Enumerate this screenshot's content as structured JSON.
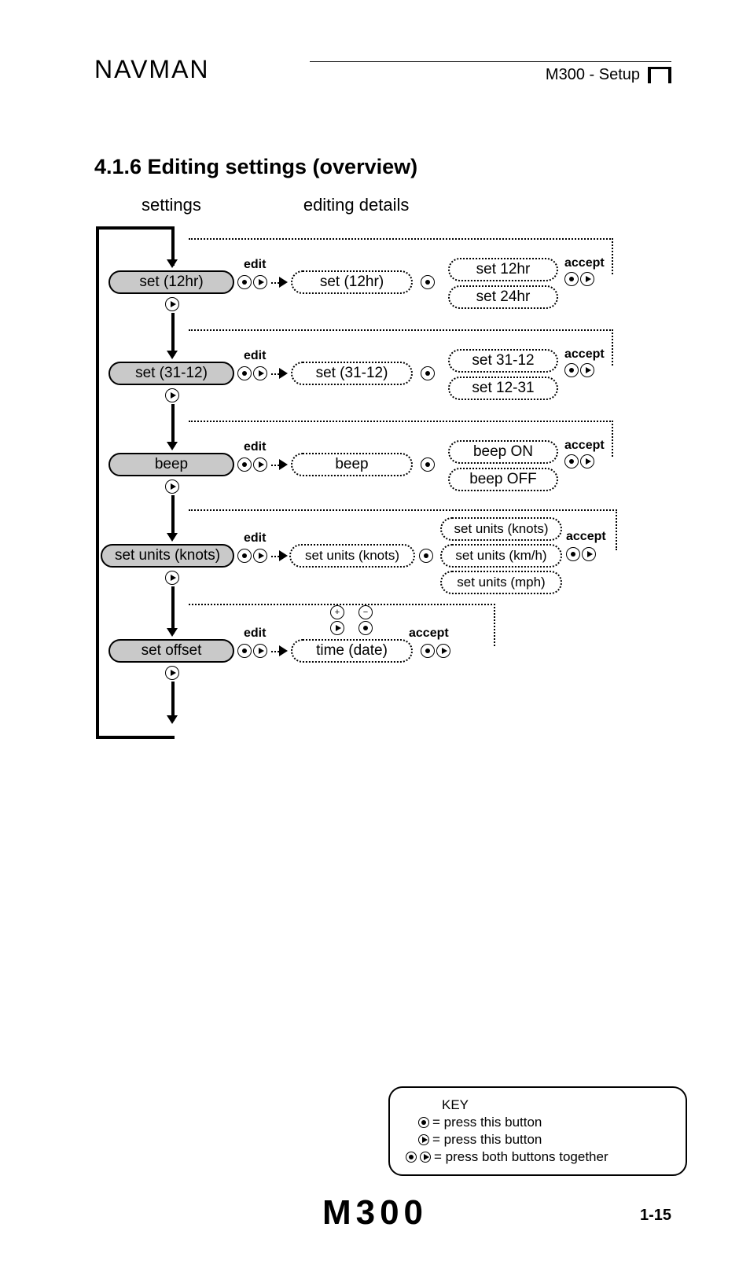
{
  "header": {
    "brand": "NAVMAN",
    "breadcrumb": "M300 - Setup"
  },
  "section_title": "4.1.6 Editing settings (overview)",
  "columns": {
    "settings": "settings",
    "details": "editing details"
  },
  "labels": {
    "edit": "edit",
    "accept": "accept",
    "plus": "+",
    "minus": "−"
  },
  "rows": [
    {
      "setting": "set (12hr)",
      "editing": "set (12hr)",
      "options": [
        "set 12hr",
        "set 24hr"
      ]
    },
    {
      "setting": "set (31-12)",
      "editing": "set (31-12)",
      "options": [
        "set 31-12",
        "set 12-31"
      ]
    },
    {
      "setting": "beep",
      "editing": "beep",
      "options": [
        "beep ON",
        "beep OFF"
      ]
    },
    {
      "setting": "set units (knots)",
      "editing": "set units (knots)",
      "options": [
        "set units (knots)",
        "set units (km/h)",
        "set units (mph)"
      ]
    },
    {
      "setting": "set offset",
      "editing": "time (date)",
      "options": []
    }
  ],
  "key": {
    "title": "KEY",
    "line1": "= press this button",
    "line2": "= press this button",
    "line3": "= press both buttons together"
  },
  "footer": {
    "model": "M300",
    "page": "1-15"
  }
}
